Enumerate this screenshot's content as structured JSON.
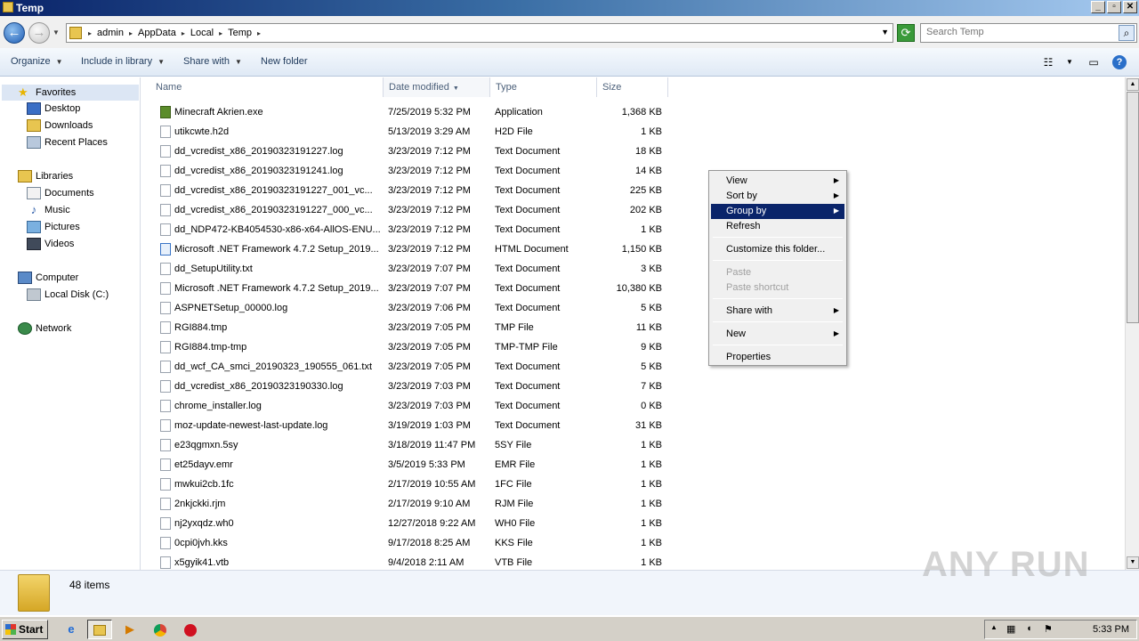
{
  "window": {
    "title": "Temp",
    "min": "_",
    "max": "▫",
    "close": "✕"
  },
  "address": {
    "crumbs": [
      "admin",
      "AppData",
      "Local",
      "Temp"
    ],
    "search_placeholder": "Search Temp"
  },
  "toolbar": {
    "organize": "Organize",
    "include_in_library": "Include in library",
    "share_with": "Share with",
    "new_folder": "New folder"
  },
  "nav": {
    "favorites": "Favorites",
    "desktop": "Desktop",
    "downloads": "Downloads",
    "recent_places": "Recent Places",
    "libraries": "Libraries",
    "documents": "Documents",
    "music": "Music",
    "pictures": "Pictures",
    "videos": "Videos",
    "computer": "Computer",
    "local_disk": "Local Disk (C:)",
    "network": "Network"
  },
  "columns": {
    "name": "Name",
    "date": "Date modified",
    "type": "Type",
    "size": "Size"
  },
  "files": [
    {
      "name": "Minecraft Akrien.exe",
      "date": "7/25/2019 5:32 PM",
      "type": "Application",
      "size": "1,368 KB",
      "icon": "exe"
    },
    {
      "name": "utikcwte.h2d",
      "date": "5/13/2019 3:29 AM",
      "type": "H2D File",
      "size": "1 KB",
      "icon": "file"
    },
    {
      "name": "dd_vcredist_x86_20190323191227.log",
      "date": "3/23/2019 7:12 PM",
      "type": "Text Document",
      "size": "18 KB",
      "icon": "file"
    },
    {
      "name": "dd_vcredist_x86_20190323191241.log",
      "date": "3/23/2019 7:12 PM",
      "type": "Text Document",
      "size": "14 KB",
      "icon": "file"
    },
    {
      "name": "dd_vcredist_x86_20190323191227_001_vc...",
      "date": "3/23/2019 7:12 PM",
      "type": "Text Document",
      "size": "225 KB",
      "icon": "file"
    },
    {
      "name": "dd_vcredist_x86_20190323191227_000_vc...",
      "date": "3/23/2019 7:12 PM",
      "type": "Text Document",
      "size": "202 KB",
      "icon": "file"
    },
    {
      "name": "dd_NDP472-KB4054530-x86-x64-AllOS-ENU...",
      "date": "3/23/2019 7:12 PM",
      "type": "Text Document",
      "size": "1 KB",
      "icon": "file"
    },
    {
      "name": "Microsoft .NET Framework 4.7.2 Setup_2019...",
      "date": "3/23/2019 7:12 PM",
      "type": "HTML Document",
      "size": "1,150 KB",
      "icon": "html"
    },
    {
      "name": "dd_SetupUtility.txt",
      "date": "3/23/2019 7:07 PM",
      "type": "Text Document",
      "size": "3 KB",
      "icon": "file"
    },
    {
      "name": "Microsoft .NET Framework 4.7.2 Setup_2019...",
      "date": "3/23/2019 7:07 PM",
      "type": "Text Document",
      "size": "10,380 KB",
      "icon": "file"
    },
    {
      "name": "ASPNETSetup_00000.log",
      "date": "3/23/2019 7:06 PM",
      "type": "Text Document",
      "size": "5 KB",
      "icon": "file"
    },
    {
      "name": "RGI884.tmp",
      "date": "3/23/2019 7:05 PM",
      "type": "TMP File",
      "size": "11 KB",
      "icon": "file"
    },
    {
      "name": "RGI884.tmp-tmp",
      "date": "3/23/2019 7:05 PM",
      "type": "TMP-TMP File",
      "size": "9 KB",
      "icon": "file"
    },
    {
      "name": "dd_wcf_CA_smci_20190323_190555_061.txt",
      "date": "3/23/2019 7:05 PM",
      "type": "Text Document",
      "size": "5 KB",
      "icon": "file"
    },
    {
      "name": "dd_vcredist_x86_20190323190330.log",
      "date": "3/23/2019 7:03 PM",
      "type": "Text Document",
      "size": "7 KB",
      "icon": "file"
    },
    {
      "name": "chrome_installer.log",
      "date": "3/23/2019 7:03 PM",
      "type": "Text Document",
      "size": "0 KB",
      "icon": "file"
    },
    {
      "name": "moz-update-newest-last-update.log",
      "date": "3/19/2019 1:03 PM",
      "type": "Text Document",
      "size": "31 KB",
      "icon": "file"
    },
    {
      "name": "e23qgmxn.5sy",
      "date": "3/18/2019 11:47 PM",
      "type": "5SY File",
      "size": "1 KB",
      "icon": "file"
    },
    {
      "name": "et25dayv.emr",
      "date": "3/5/2019 5:33 PM",
      "type": "EMR File",
      "size": "1 KB",
      "icon": "file"
    },
    {
      "name": "mwkui2cb.1fc",
      "date": "2/17/2019 10:55 AM",
      "type": "1FC File",
      "size": "1 KB",
      "icon": "file"
    },
    {
      "name": "2nkjckki.rjm",
      "date": "2/17/2019 9:10 AM",
      "type": "RJM File",
      "size": "1 KB",
      "icon": "file"
    },
    {
      "name": "nj2yxqdz.wh0",
      "date": "12/27/2018 9:22 AM",
      "type": "WH0 File",
      "size": "1 KB",
      "icon": "file"
    },
    {
      "name": "0cpi0jvh.kks",
      "date": "9/17/2018 8:25 AM",
      "type": "KKS File",
      "size": "1 KB",
      "icon": "file"
    },
    {
      "name": "x5gyik41.vtb",
      "date": "9/4/2018 2:11 AM",
      "type": "VTB File",
      "size": "1 KB",
      "icon": "file"
    }
  ],
  "context_menu": {
    "view": "View",
    "sort_by": "Sort by",
    "group_by": "Group by",
    "refresh": "Refresh",
    "customize": "Customize this folder...",
    "paste": "Paste",
    "paste_shortcut": "Paste shortcut",
    "share_with": "Share with",
    "new": "New",
    "properties": "Properties"
  },
  "details": {
    "count": "48 items"
  },
  "watermark": "ANY RUN",
  "taskbar": {
    "start": "Start",
    "clock": "5:33 PM"
  }
}
